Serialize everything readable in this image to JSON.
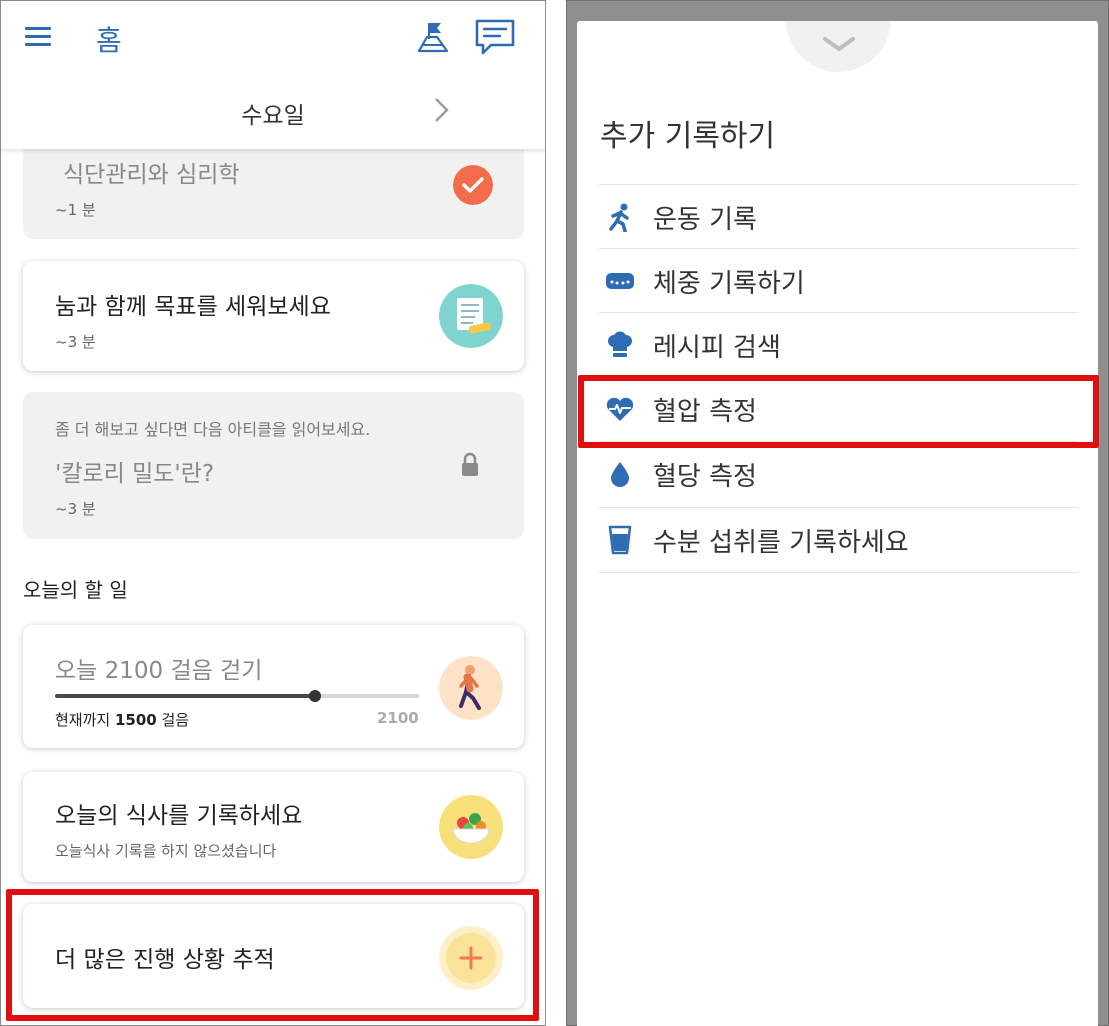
{
  "left": {
    "header": {
      "title": "홈",
      "day": "수요일"
    },
    "lessons": [
      {
        "title": "식단관리와 심리학",
        "duration": "~1 분",
        "status": "completed"
      },
      {
        "title": "눔과 함께 목표를 세워보세요",
        "duration": "~3 분"
      },
      {
        "hint": "좀 더 해보고 싶다면 다음 아티클을 읽어보세요.",
        "title": "'칼로리 밀도'란?",
        "duration": "~3 분",
        "status": "locked"
      }
    ],
    "todo": {
      "section_title": "오늘의 할 일",
      "steps": {
        "title": "오늘 2100 걸음 걷기",
        "current_prefix": "현재까지 ",
        "current_value": "1500",
        "current_suffix": " 걸음",
        "goal": "2100",
        "progress": 0.7143
      },
      "meal": {
        "title": "오늘의 식사를 기록하세요",
        "subtitle": "오늘식사 기록을 하지 않으셨습니다"
      },
      "more": {
        "title": "더 많은 진행 상황 추적"
      }
    }
  },
  "right": {
    "sheet_title": "추가 기록하기",
    "items": [
      {
        "label": "운동 기록",
        "icon": "running-icon"
      },
      {
        "label": "체중 기록하기",
        "icon": "scale-icon"
      },
      {
        "label": "레시피 검색",
        "icon": "chef-hat-icon"
      },
      {
        "label": "혈압 측정",
        "icon": "heart-pulse-icon"
      },
      {
        "label": "혈당 측정",
        "icon": "water-drop-icon"
      },
      {
        "label": "수분 섭취를 기록하세요",
        "icon": "water-glass-icon"
      }
    ]
  },
  "colors": {
    "accent_blue": "#2e6db4",
    "check_orange": "#f26b4b",
    "highlight_red": "#e01010"
  }
}
